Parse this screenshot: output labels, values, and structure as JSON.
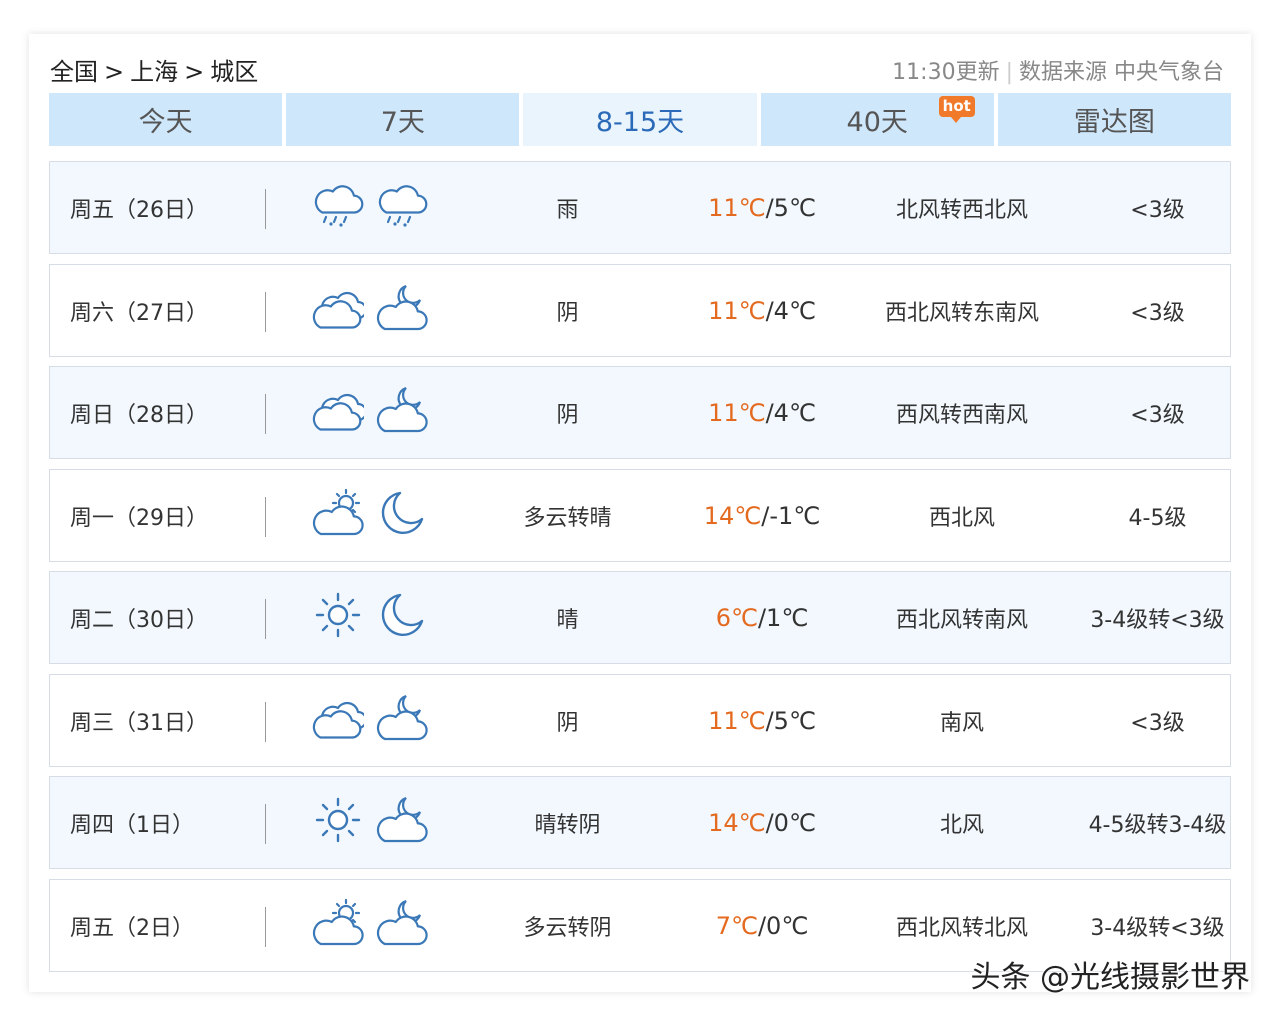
{
  "breadcrumb": [
    "全国",
    "上海",
    "城区"
  ],
  "breadcrumb_sep": ">",
  "source": {
    "updated": "11:30更新",
    "label": "数据来源 中央气象台"
  },
  "tabs": [
    {
      "label": "今天"
    },
    {
      "label": "7天"
    },
    {
      "label": "8-15天",
      "active": true
    },
    {
      "label": "40天",
      "badge": "hot"
    },
    {
      "label": "雷达图"
    }
  ],
  "colors": {
    "tab_bg": "#cfe7fb",
    "active_tab_text": "#2a6ab8",
    "high_temp": "#e36a1f",
    "hot_badge": "#f07a2a"
  },
  "forecast": [
    {
      "day": "周五（26日）",
      "icon_day": "rain-cloud-icon",
      "icon_night": "rain-cloud-icon",
      "weather": "雨",
      "high": "11℃",
      "low": "5℃",
      "wind": "北风转西北风",
      "level": "<3级"
    },
    {
      "day": "周六（27日）",
      "icon_day": "overcast-cloud-icon",
      "icon_night": "cloudy-night-icon",
      "weather": "阴",
      "high": "11℃",
      "low": "4℃",
      "wind": "西北风转东南风",
      "level": "<3级"
    },
    {
      "day": "周日（28日）",
      "icon_day": "overcast-cloud-icon",
      "icon_night": "cloudy-night-icon",
      "weather": "阴",
      "high": "11℃",
      "low": "4℃",
      "wind": "西风转西南风",
      "level": "<3级"
    },
    {
      "day": "周一（29日）",
      "icon_day": "partly-cloudy-icon",
      "icon_night": "moon-icon",
      "weather": "多云转晴",
      "high": "14℃",
      "low": "-1℃",
      "wind": "西北风",
      "level": "4-5级"
    },
    {
      "day": "周二（30日）",
      "icon_day": "sun-icon",
      "icon_night": "moon-icon",
      "weather": "晴",
      "high": "6℃",
      "low": "1℃",
      "wind": "西北风转南风",
      "level": "3-4级转<3级"
    },
    {
      "day": "周三（31日）",
      "icon_day": "overcast-cloud-icon",
      "icon_night": "cloudy-night-icon",
      "weather": "阴",
      "high": "11℃",
      "low": "5℃",
      "wind": "南风",
      "level": "<3级"
    },
    {
      "day": "周四（1日）",
      "icon_day": "sun-icon",
      "icon_night": "cloudy-night-icon",
      "weather": "晴转阴",
      "high": "14℃",
      "low": "0℃",
      "wind": "北风",
      "level": "4-5级转3-4级"
    },
    {
      "day": "周五（2日）",
      "icon_day": "partly-cloudy-icon",
      "icon_night": "cloudy-night-icon",
      "weather": "多云转阴",
      "high": "7℃",
      "low": "0℃",
      "wind": "西北风转北风",
      "level": "3-4级转<3级"
    }
  ],
  "watermark": "头条 @光线摄影世界"
}
